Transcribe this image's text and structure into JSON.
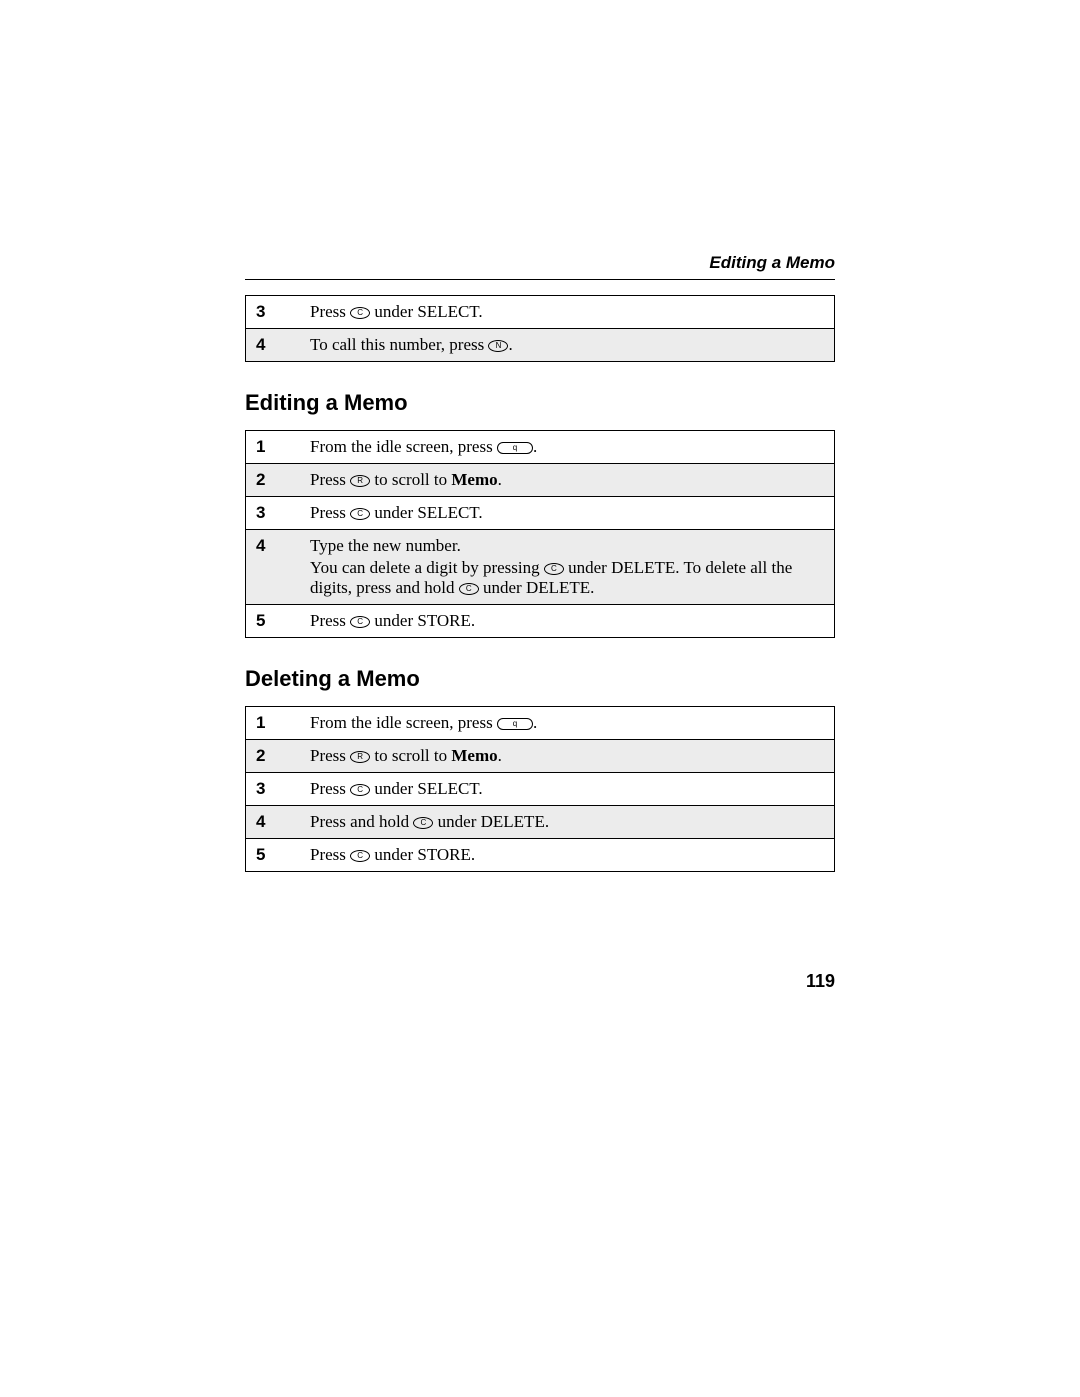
{
  "page": {
    "running_head": "Editing a Memo",
    "page_number": "119"
  },
  "table1": {
    "rows": [
      {
        "num": "3",
        "pre": "Press ",
        "icon": "C",
        "post": " under SELECT.",
        "shade": false
      },
      {
        "num": "4",
        "pre": "To call this number, press ",
        "icon": "N",
        "post": ".",
        "shade": true
      }
    ]
  },
  "section2": {
    "title": "Editing a Memo",
    "rows": [
      {
        "num": "1",
        "pre": "From the idle screen, press ",
        "iconType": "wide",
        "icon": "q",
        "post": ".",
        "shade": false
      },
      {
        "num": "2",
        "pre": "Press ",
        "icon": "R",
        "mid": " to scroll to ",
        "bold": "Memo",
        "post": ".",
        "shade": true
      },
      {
        "num": "3",
        "pre": "Press ",
        "icon": "C",
        "post": " under SELECT.",
        "shade": false
      },
      {
        "num": "4",
        "line1": "Type the new number.",
        "sub_pre": "You can delete a digit by pressing ",
        "sub_icon1": "C",
        "sub_mid": " under DELETE. To delete all the digits, press and hold ",
        "sub_icon2": "C",
        "sub_post": " under DELETE.",
        "shade": true
      },
      {
        "num": "5",
        "pre": "Press ",
        "icon": "C",
        "post": " under STORE.",
        "shade": false
      }
    ]
  },
  "section3": {
    "title": "Deleting a Memo",
    "rows": [
      {
        "num": "1",
        "pre": "From the idle screen, press ",
        "iconType": "wide",
        "icon": "q",
        "post": ".",
        "shade": false
      },
      {
        "num": "2",
        "pre": "Press ",
        "icon": "R",
        "mid": " to scroll to ",
        "bold": "Memo",
        "post": ".",
        "shade": true
      },
      {
        "num": "3",
        "pre": "Press ",
        "icon": "C",
        "post": " under SELECT.",
        "shade": false
      },
      {
        "num": "4",
        "pre": "Press and hold ",
        "icon": "C",
        "post": " under DELETE.",
        "shade": true
      },
      {
        "num": "5",
        "pre": "Press ",
        "icon": "C",
        "post": " under STORE.",
        "shade": false
      }
    ]
  }
}
